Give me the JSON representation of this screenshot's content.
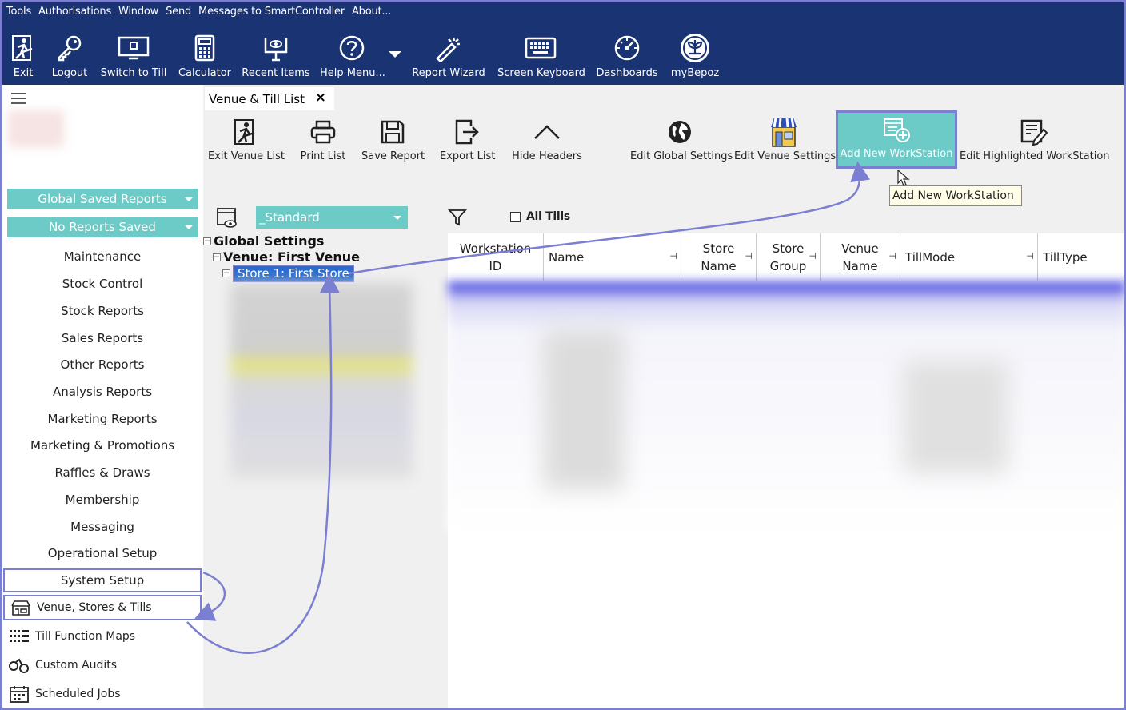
{
  "menubar": [
    "Tools",
    "Authorisations",
    "Window",
    "Send",
    "Messages to SmartController",
    "About..."
  ],
  "toolbar": [
    {
      "label": "Exit",
      "icon": "exit-icon"
    },
    {
      "label": "Logout",
      "icon": "key-icon"
    },
    {
      "label": "Switch to Till",
      "icon": "till-icon"
    },
    {
      "label": "Calculator",
      "icon": "calculator-icon"
    },
    {
      "label": "Recent Items",
      "icon": "recent-items-icon"
    },
    {
      "label": "Help Menu...",
      "icon": "help-icon"
    },
    {
      "label": "Report Wizard",
      "icon": "wand-icon"
    },
    {
      "label": "Screen Keyboard",
      "icon": "keyboard-icon"
    },
    {
      "label": "Dashboards",
      "icon": "gauge-icon"
    },
    {
      "label": "myBepoz",
      "icon": "bepoz-icon"
    }
  ],
  "sidebar": {
    "saved_reports": "Global Saved Reports",
    "no_reports": "No Reports Saved",
    "items": [
      "Maintenance",
      "Stock Control",
      "Stock Reports",
      "Sales Reports",
      "Other Reports",
      "Analysis Reports",
      "Marketing Reports",
      "Marketing & Promotions",
      "Raffles & Draws",
      "Membership",
      "Messaging",
      "Operational Setup",
      "System Setup"
    ],
    "subitems": [
      "Venue, Stores & Tills",
      "Till Function Maps",
      "Custom Audits",
      "Scheduled Jobs"
    ]
  },
  "tab": {
    "label": "Venue & Till List",
    "close": "×"
  },
  "ribbon": [
    "Exit Venue List",
    "Print List",
    "Save Report",
    "Export List",
    "Hide Headers",
    "Edit Global Settings",
    "Edit Venue Settings",
    "Add New WorkStation",
    "Edit Highlighted WorkStation"
  ],
  "tooltip": "Add New WorkStation",
  "filter": {
    "layout": "_Standard",
    "all_tills": "All Tills"
  },
  "tree": {
    "root": "Global Settings",
    "venue": "Venue: First Venue",
    "store": "Store 1: First Store"
  },
  "columns": [
    "Workstation ID",
    "Name",
    "Store Name",
    "Store Group",
    "Venue Name",
    "TillMode",
    "TillType"
  ],
  "colors": {
    "navy": "#1a3372",
    "teal": "#6ccbc6",
    "accent": "#7b7fd1",
    "selection": "#2a6ccd"
  }
}
